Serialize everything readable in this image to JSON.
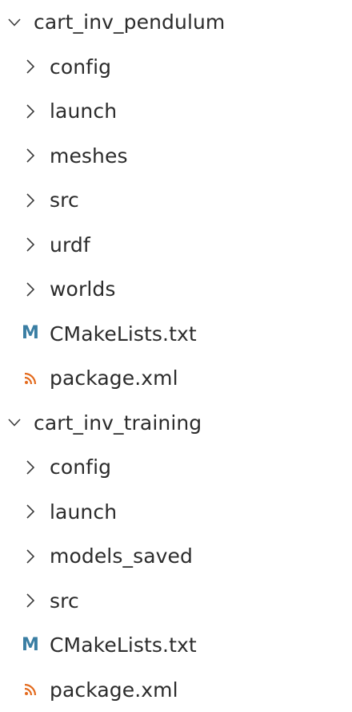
{
  "colors": {
    "text": "#2b2b2b",
    "cmake_icon": "#3a7ea3",
    "xml_icon": "#e36b1e"
  },
  "tree": {
    "folder1": {
      "label": "cart_inv_pendulum",
      "state": "expanded",
      "children": {
        "config": "config",
        "launch": "launch",
        "meshes": "meshes",
        "src": "src",
        "urdf": "urdf",
        "worlds": "worlds",
        "cmake_icon_letter": "M",
        "cmake": "CMakeLists.txt",
        "package": "package.xml"
      }
    },
    "folder2": {
      "label": "cart_inv_training",
      "state": "expanded",
      "children": {
        "config": "config",
        "launch": "launch",
        "models_saved": "models_saved",
        "src": "src",
        "cmake_icon_letter": "M",
        "cmake": "CMakeLists.txt",
        "package": "package.xml"
      }
    }
  },
  "icons": {
    "expanded": "chevron-down-icon",
    "collapsed": "chevron-right-icon",
    "cmake": "cmake-m-icon",
    "xml": "rss-feed-icon"
  }
}
